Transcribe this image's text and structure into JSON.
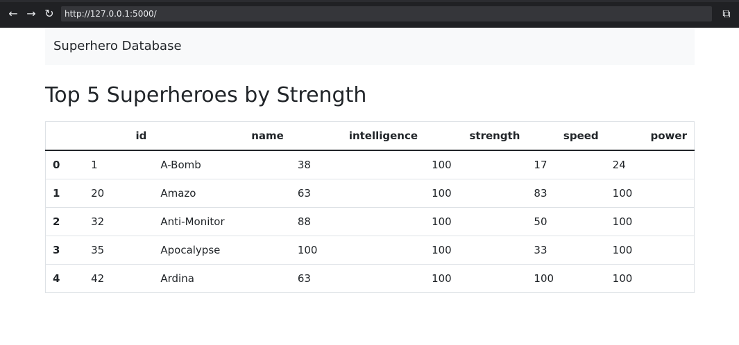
{
  "browser": {
    "url": "http://127.0.0.1:5000/",
    "back_icon": "arrow-left-icon",
    "forward_icon": "arrow-right-icon",
    "reload_icon": "reload-icon",
    "open_icon": "open-external-icon"
  },
  "navbar": {
    "brand": "Superhero Database"
  },
  "page": {
    "title": "Top 5 Superheroes by Strength"
  },
  "table": {
    "columns": [
      "",
      "id",
      "name",
      "intelligence",
      "strength",
      "speed",
      "power"
    ],
    "rows": [
      {
        "index": "0",
        "id": "1",
        "name": "A-Bomb",
        "intelligence": "38",
        "strength": "100",
        "speed": "17",
        "power": "24"
      },
      {
        "index": "1",
        "id": "20",
        "name": "Amazo",
        "intelligence": "63",
        "strength": "100",
        "speed": "83",
        "power": "100"
      },
      {
        "index": "2",
        "id": "32",
        "name": "Anti-Monitor",
        "intelligence": "88",
        "strength": "100",
        "speed": "50",
        "power": "100"
      },
      {
        "index": "3",
        "id": "35",
        "name": "Apocalypse",
        "intelligence": "100",
        "strength": "100",
        "speed": "33",
        "power": "100"
      },
      {
        "index": "4",
        "id": "42",
        "name": "Ardina",
        "intelligence": "63",
        "strength": "100",
        "speed": "100",
        "power": "100"
      }
    ]
  }
}
